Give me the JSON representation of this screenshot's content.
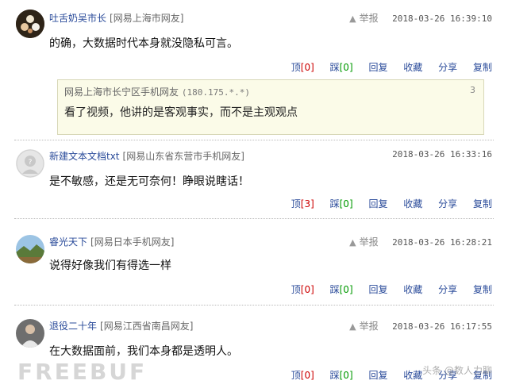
{
  "report_label": "举报",
  "actions": {
    "up": "顶",
    "down": "踩",
    "reply": "回复",
    "fav": "收藏",
    "share": "分享",
    "copy": "复制"
  },
  "comments": [
    {
      "user": "吐舌奶吴市长",
      "location": "[网易上海市网友]",
      "datetime": "2018-03-26 16:39:10",
      "text": "的确，大数据时代本身就没隐私可言。",
      "up": "[0]",
      "down": "[0]"
    },
    {
      "user": "新建文本文档txt",
      "location": "[网易山东省东营市手机网友]",
      "datetime": "2018-03-26 16:33:16",
      "text": "是不敏感，还是无可奈何！睁眼说瞎话！",
      "up": "[3]",
      "down": "[0]"
    },
    {
      "user": "睿光天下",
      "location": "[网易日本手机网友]",
      "datetime": "2018-03-26 16:28:21",
      "text": "说得好像我们有得选一样",
      "up": "[0]",
      "down": "[0]"
    },
    {
      "user": "退役二十年",
      "location": "[网易江西省南昌网友]",
      "datetime": "2018-03-26 16:17:55",
      "text": "在大数据面前，我们本身都是透明人。",
      "up": "[0]",
      "down": "[0]"
    }
  ],
  "quote": {
    "header": "网易上海市长宁区手机网友",
    "ip": "(180.175.*.*)",
    "floor": "3",
    "text": "看了视频，他讲的是客观事实，而不是主观观点"
  },
  "watermark": "FREEBUF",
  "brand": "头条 @数人力聊"
}
